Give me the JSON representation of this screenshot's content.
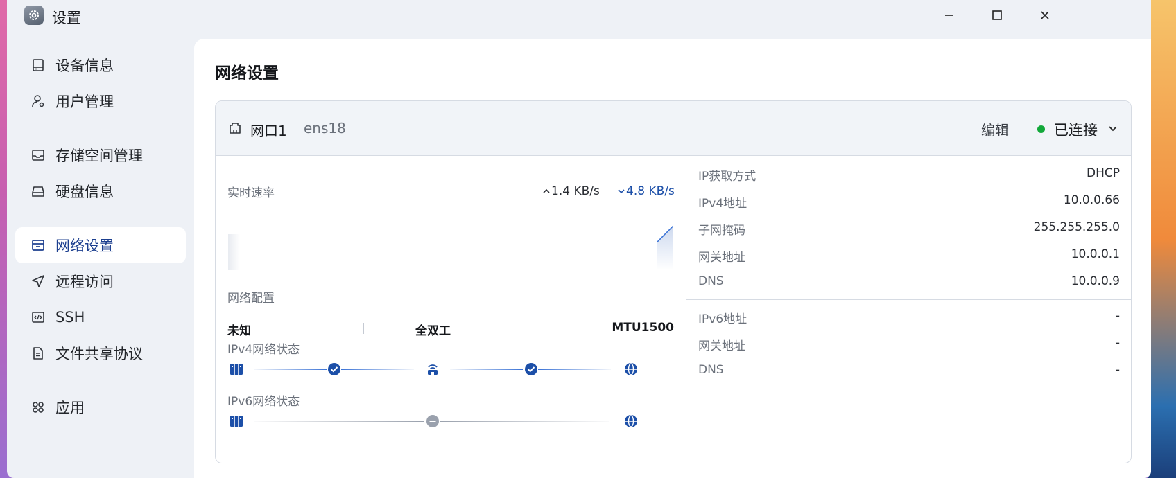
{
  "window": {
    "title": "设置"
  },
  "sidebar": {
    "items": [
      {
        "label": "设备信息",
        "icon": "device-icon"
      },
      {
        "label": "用户管理",
        "icon": "user-gear-icon"
      },
      {
        "label": "存储空间管理",
        "icon": "storage-icon"
      },
      {
        "label": "硬盘信息",
        "icon": "disk-icon"
      },
      {
        "label": "网络设置",
        "icon": "network-icon",
        "active": true
      },
      {
        "label": "远程访问",
        "icon": "send-icon"
      },
      {
        "label": "SSH",
        "icon": "code-icon"
      },
      {
        "label": "文件共享协议",
        "icon": "file-icon"
      },
      {
        "label": "应用",
        "icon": "apps-icon"
      }
    ]
  },
  "main": {
    "title": "网络设置",
    "card": {
      "port_name": "网口1",
      "device": "ens18",
      "edit_label": "编辑",
      "status": "已连接",
      "status_color": "#12a83a",
      "speed": {
        "label": "实时速率",
        "upload": "1.4 KB/s",
        "download": "4.8 KB/s"
      },
      "config": {
        "label": "网络配置",
        "speed_mode": "未知",
        "duplex": "全双工",
        "mtu": "MTU1500"
      },
      "ipv4_status": {
        "label": "IPv4网络状态",
        "lan_ok": true,
        "wan_ok": true
      },
      "ipv6_status": {
        "label": "IPv6网络状态",
        "state": "disabled"
      },
      "ipv4_info": [
        {
          "key": "IP获取方式",
          "value": "DHCP"
        },
        {
          "key": "IPv4地址",
          "value": "10.0.0.66"
        },
        {
          "key": "子网掩码",
          "value": "255.255.255.0"
        },
        {
          "key": "网关地址",
          "value": "10.0.0.1"
        },
        {
          "key": "DNS",
          "value": "10.0.0.9"
        }
      ],
      "ipv6_info": [
        {
          "key": "IPv6地址",
          "value": "-"
        },
        {
          "key": "网关地址",
          "value": "-"
        },
        {
          "key": "DNS",
          "value": "-"
        }
      ]
    }
  },
  "colors": {
    "accent": "#1c4fa8",
    "active_nav": "#1c3f8f"
  }
}
